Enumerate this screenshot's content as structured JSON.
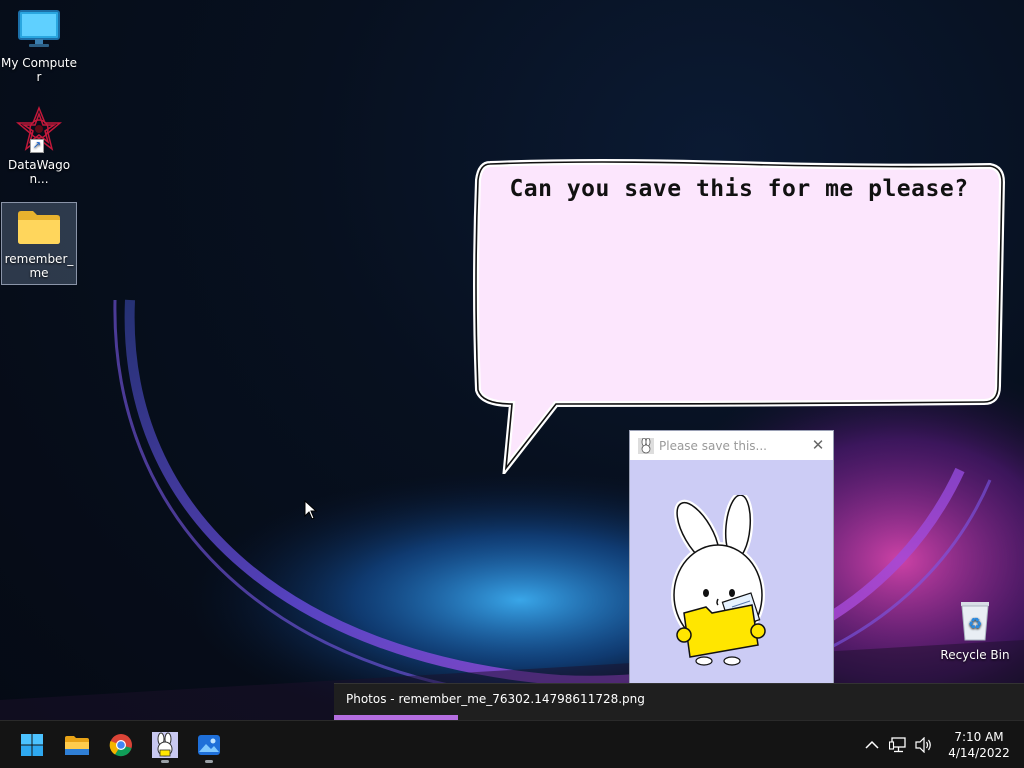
{
  "desktop": {
    "icons": [
      {
        "label": "My Computer"
      },
      {
        "label": "DataWagon..."
      },
      {
        "label": "remember_me"
      },
      {
        "label": "Recycle Bin"
      }
    ]
  },
  "bubble": {
    "text": "Can you save this for me please?"
  },
  "mini_window": {
    "title": "Please save this..."
  },
  "taskbar_preview": {
    "title": "Photos - remember_me_76302.14798611728.png",
    "progress": 0.18
  },
  "taskbar": {
    "apps": [
      {
        "icon": "windows-start-icon"
      },
      {
        "icon": "file-explorer-icon"
      },
      {
        "icon": "chrome-icon"
      },
      {
        "icon": "bunny-app-icon"
      },
      {
        "icon": "photos-icon"
      }
    ]
  },
  "tray": {
    "time": "7:10 AM",
    "date": "4/14/2022"
  },
  "colors": {
    "bubble_fill": "#fce6fd",
    "window_bg": "#ccccf5",
    "progress": "#b46ee0"
  }
}
